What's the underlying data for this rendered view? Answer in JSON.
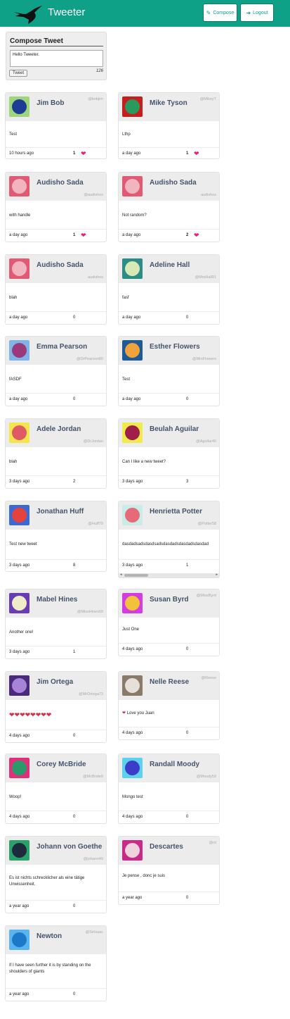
{
  "app": {
    "brand": "Tweeter",
    "compose_label": "Compose",
    "logout_label": "Logout",
    "accent_color": "#0fa088"
  },
  "compose": {
    "title": "Compose Tweet",
    "input_value": "Hello Tweeter.",
    "button_label": "Tweet",
    "char_count": "126"
  },
  "tweets": [
    {
      "name": "Jim Bob",
      "handle": "@bobjim",
      "text": [
        "Test"
      ],
      "time": "10 hours ago",
      "likes": "1",
      "liked": true,
      "avatar_bg": "#9fd67a",
      "face": "#1e3c96"
    },
    {
      "name": "Mike Tyson",
      "handle": "@MikeyT",
      "text": [
        "Lthp"
      ],
      "time": "a day ago",
      "likes": "1",
      "liked": true,
      "avatar_bg": "#c61e1e",
      "face": "#2a9a5c"
    },
    {
      "name": "Audisho Sada",
      "handle": "@audishos",
      "text": [
        "with handle"
      ],
      "time": "a day ago",
      "likes": "1",
      "liked": true,
      "avatar_bg": "#e05a74",
      "face": "#f2b5bf"
    },
    {
      "name": "Audisho Sada",
      "handle": "audishos",
      "text": [
        "Not random?"
      ],
      "time": "a day ago",
      "likes": "2",
      "liked": true,
      "avatar_bg": "#e05a74",
      "face": "#f2b5bf"
    },
    {
      "name": "Audisho Sada",
      "handle": "audishos",
      "text": [
        "blah"
      ],
      "time": "a day ago",
      "likes": "0",
      "liked": false,
      "avatar_bg": "#e05a74",
      "face": "#f2b5bf"
    },
    {
      "name": "Adeline Hall",
      "handle": "@MrsHall91",
      "text": [
        "fasf"
      ],
      "time": "a day ago",
      "likes": "0",
      "liked": false,
      "avatar_bg": "#2c8c86",
      "face": "#d8e9b6"
    },
    {
      "name": "Emma Pearson",
      "handle": "@DrPearson80",
      "text": [
        "fASDF"
      ],
      "time": "a day ago",
      "likes": "0",
      "liked": false,
      "avatar_bg": "#7fb4e8",
      "face": "#9a3a7a"
    },
    {
      "name": "Esther Flowers",
      "handle": "@MrsFlowers",
      "text": [
        "Test"
      ],
      "time": "a day ago",
      "likes": "0",
      "liked": false,
      "avatar_bg": "#1e5a96",
      "face": "#f0a23c"
    },
    {
      "name": "Adele Jordan",
      "handle": "@DrJordan",
      "text": [
        "blah"
      ],
      "time": "3 days ago",
      "likes": "2",
      "liked": false,
      "avatar_bg": "#f4e54c",
      "face": "#e05a66"
    },
    {
      "name": "Beulah Aguilar",
      "handle": "@Aguilar40",
      "text": [
        "Can I like a new tweet?"
      ],
      "time": "3 days ago",
      "likes": "3",
      "liked": false,
      "avatar_bg": "#f0ea4a",
      "face": "#a01e4a"
    },
    {
      "name": "Jonathan Huff",
      "handle": "@Huff79",
      "text": [
        "Test new tweet"
      ],
      "time": "3 days ago",
      "likes": "8",
      "liked": false,
      "avatar_bg": "#3c6ad2",
      "face": "#e6423c"
    },
    {
      "name": "Henrietta Potter",
      "handle": "@Potter58",
      "text": [
        "dasdadsadsdasdsadsdasdadsdasdadsdasdad"
      ],
      "time": "3 days ago",
      "likes": "1",
      "liked": false,
      "avatar_bg": "#c8ece8",
      "face": "#e66a78"
    },
    {
      "name": "Mabel Hines",
      "handle": "@MissHines69",
      "text": [
        "Another one!"
      ],
      "time": "3 days ago",
      "likes": "1",
      "liked": false,
      "avatar_bg": "#6a3cb4",
      "face": "#f0ecc8"
    },
    {
      "name": "Susan Byrd",
      "handle": "@MissByrd",
      "text": [
        "Just One"
      ],
      "time": "4 days ago",
      "likes": "0",
      "liked": false,
      "avatar_bg": "#d23ce0",
      "face": "#f2c23a"
    },
    {
      "name": "Jim Ortega",
      "handle": "@MrOrtega73",
      "text": [
        "❤❤❤❤❤❤❤❤"
      ],
      "time": "4 days ago",
      "likes": "0",
      "liked": false,
      "avatar_bg": "#4a2a7a",
      "face": "#a884d8"
    },
    {
      "name": "Nelle Reese",
      "handle": "@Reese",
      "text": [
        "❤ Love you Juan"
      ],
      "time": "4 days ago",
      "likes": "0",
      "liked": false,
      "avatar_bg": "#8a7a6a",
      "face": "#e6e0d8"
    },
    {
      "name": "Corey McBride",
      "handle": "@McBride9",
      "text": [
        "Woop!"
      ],
      "time": "4 days ago",
      "likes": "0",
      "liked": false,
      "avatar_bg": "#e0307a",
      "face": "#2a9a6a"
    },
    {
      "name": "Randall Moody",
      "handle": "@Moody59",
      "text": [
        "Mongo test"
      ],
      "time": "4 days ago",
      "likes": "0",
      "liked": false,
      "avatar_bg": "#5ad2f0",
      "face": "#3c3cc8"
    },
    {
      "name": "Johann von Goethe",
      "handle": "@johann49",
      "text": [
        "Es ist nichts schrecklicher als eine tätige",
        "Unwissenheit."
      ],
      "time": "a year ago",
      "likes": "0",
      "liked": false,
      "avatar_bg": "#2aa06a",
      "face": "#1e2a3c"
    },
    {
      "name": "Descartes",
      "handle": "@rd",
      "text": [
        "Je pense , donc je suis"
      ],
      "time": "a year ago",
      "likes": "0",
      "liked": false,
      "avatar_bg": "#c82a8a",
      "face": "#f0d2dc"
    },
    {
      "name": "Newton",
      "handle": "@SirIsaac",
      "text": [
        "If I have seen further it is by standing on the",
        "shoulders of giants"
      ],
      "time": "a year ago",
      "likes": "0",
      "liked": false,
      "avatar_bg": "#5ab4f0",
      "face": "#1e78c8"
    }
  ]
}
